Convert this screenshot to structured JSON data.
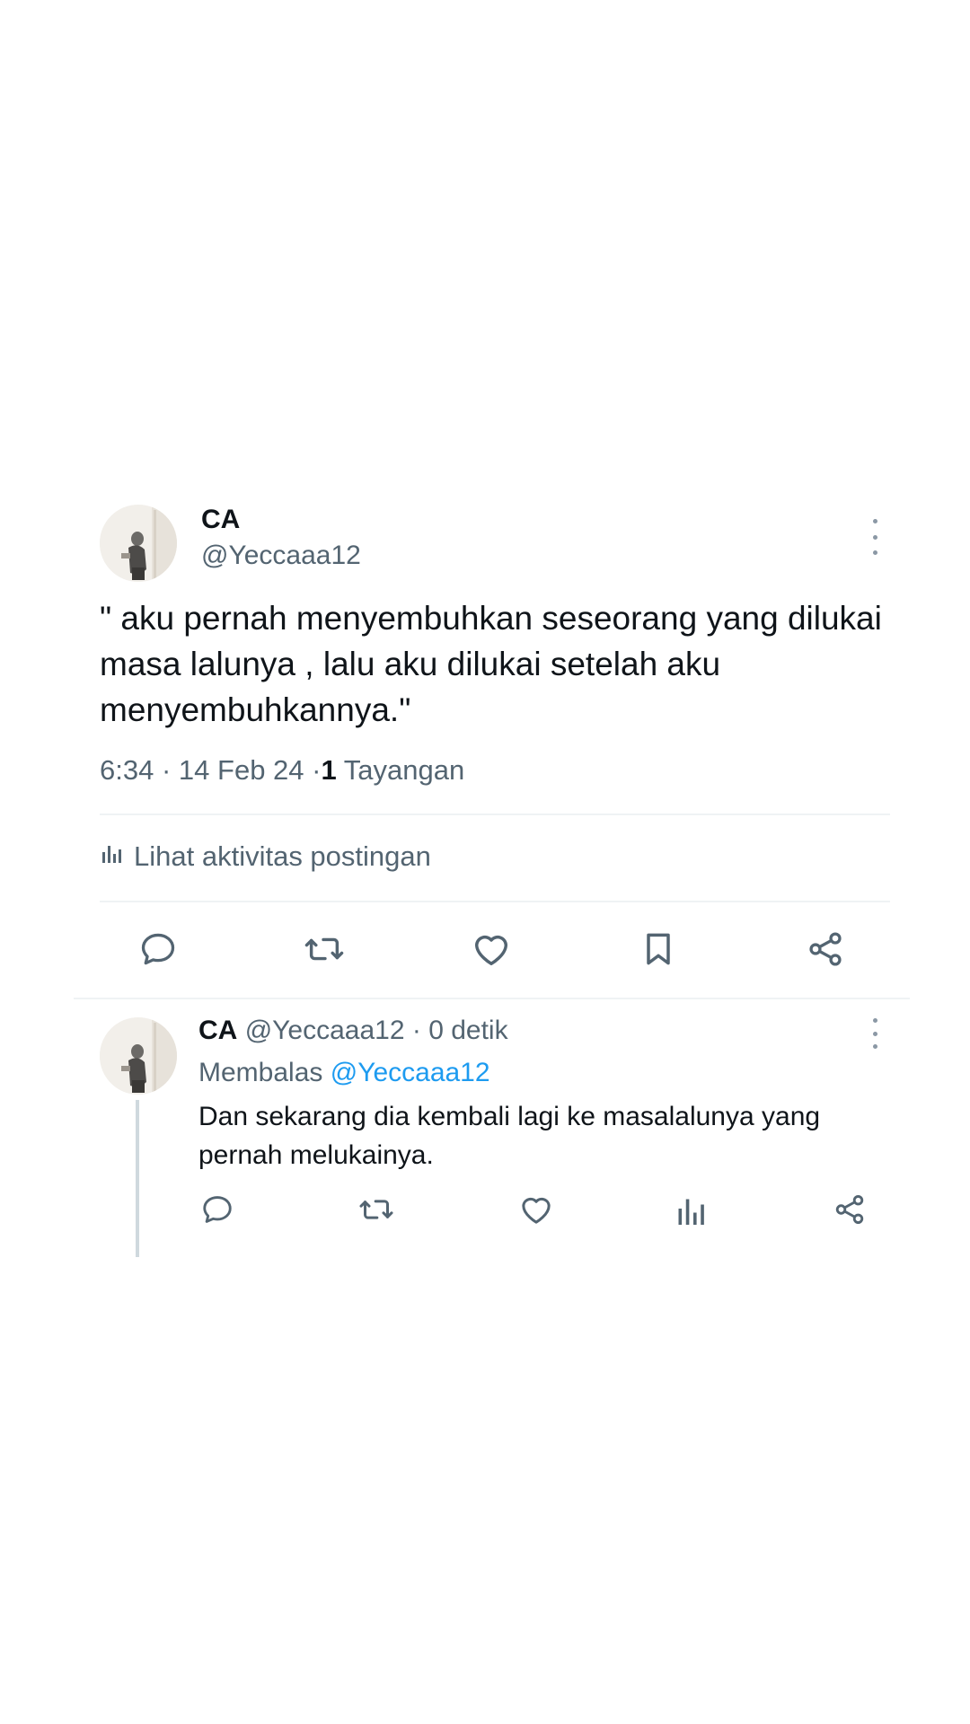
{
  "main_tweet": {
    "display_name": "CA",
    "handle": "@Yeccaaa12",
    "text": "\" aku pernah menyembuhkan seseorang yang dilukai masa lalunya , lalu aku dilukai setelah aku menyembuhkannya.\"",
    "time": "6:34",
    "separator": "·",
    "date": "14 Feb 24",
    "views_count": "1",
    "views_label": "Tayangan",
    "activity_label": "Lihat aktivitas postingan",
    "actions": [
      "reply-icon",
      "retweet-icon",
      "like-icon",
      "bookmark-icon",
      "share-icon"
    ]
  },
  "reply": {
    "display_name": "CA",
    "handle": "@Yeccaaa12",
    "time_ago": "0 detik",
    "replying_prefix": "Membalas",
    "replying_to": "@Yeccaaa12",
    "text": "Dan sekarang dia kembali lagi ke masalalunya yang pernah melukainya.",
    "actions": [
      "reply-icon",
      "retweet-icon",
      "like-icon",
      "views-icon",
      "share-icon"
    ]
  },
  "colors": {
    "text_primary": "#0f1419",
    "text_secondary": "#536471",
    "link": "#1d9bf0",
    "divider": "#eff3f4",
    "icon": "#536471"
  }
}
